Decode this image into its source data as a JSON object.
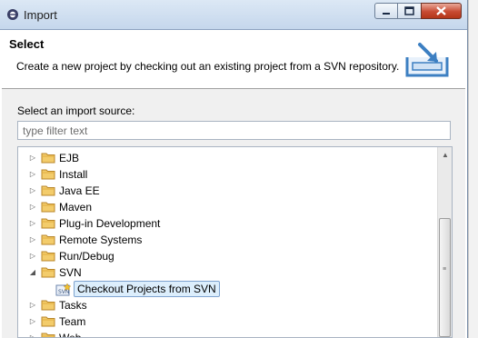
{
  "window": {
    "title": "Import"
  },
  "header": {
    "title": "Select",
    "description": "Create a new project by checking out an existing project from a SVN repository.",
    "banner_icon": "import-wizard-icon"
  },
  "body": {
    "source_label": "Select an import source:",
    "filter_placeholder": "type filter text"
  },
  "tree": {
    "items": [
      {
        "label": "EJB",
        "expanded": false,
        "icon": "folder-icon"
      },
      {
        "label": "Install",
        "expanded": false,
        "icon": "folder-icon"
      },
      {
        "label": "Java EE",
        "expanded": false,
        "icon": "folder-icon"
      },
      {
        "label": "Maven",
        "expanded": false,
        "icon": "folder-icon"
      },
      {
        "label": "Plug-in Development",
        "expanded": false,
        "icon": "folder-icon"
      },
      {
        "label": "Remote Systems",
        "expanded": false,
        "icon": "folder-icon"
      },
      {
        "label": "Run/Debug",
        "expanded": false,
        "icon": "folder-icon"
      },
      {
        "label": "SVN",
        "expanded": true,
        "icon": "folder-icon"
      },
      {
        "label": "Checkout Projects from SVN",
        "selected": true,
        "icon": "svn-checkout-icon"
      },
      {
        "label": "Tasks",
        "expanded": false,
        "icon": "folder-icon"
      },
      {
        "label": "Team",
        "expanded": false,
        "icon": "folder-icon"
      },
      {
        "label": "Web",
        "expanded": false,
        "icon": "folder-icon"
      }
    ]
  },
  "colors": {
    "titlebar": "#c5d7ec",
    "close": "#c84b33",
    "selection": "#dceefc",
    "folder": "#e8b94a"
  }
}
